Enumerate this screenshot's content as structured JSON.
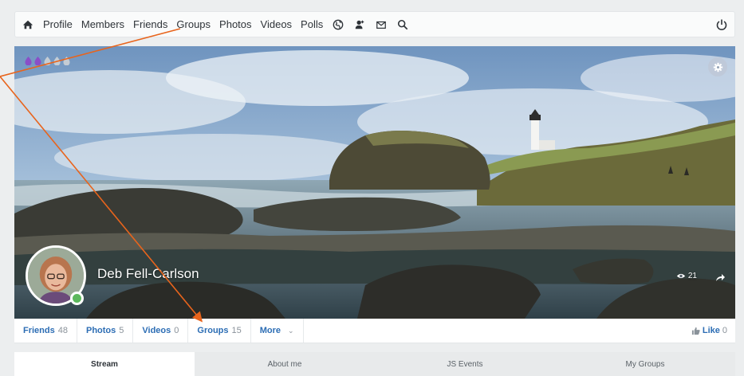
{
  "topnav": {
    "items": [
      "Profile",
      "Members",
      "Friends",
      "Groups",
      "Photos",
      "Videos",
      "Polls"
    ],
    "icons": [
      "home-icon",
      "globe-icon",
      "user-add-icon",
      "envelope-icon",
      "search-icon",
      "power-icon"
    ]
  },
  "profile": {
    "name": "Deb Fell-Carlson",
    "views": "21",
    "drops_filled": 2,
    "drops_total": 5
  },
  "stats": [
    {
      "label": "Friends",
      "count": "48"
    },
    {
      "label": "Photos",
      "count": "5"
    },
    {
      "label": "Videos",
      "count": "0"
    },
    {
      "label": "Groups",
      "count": "15"
    },
    {
      "label": "More",
      "count": ""
    }
  ],
  "like": {
    "label": "Like",
    "count": "0"
  },
  "tabs": [
    "Stream",
    "About me",
    "JS Events",
    "My Groups"
  ],
  "colors": {
    "link": "#2c6db4",
    "drop_filled": "#8a4fc8",
    "drop_empty": "#c4ccd4",
    "online": "#5cb85c",
    "annotation": "#e8641c"
  }
}
